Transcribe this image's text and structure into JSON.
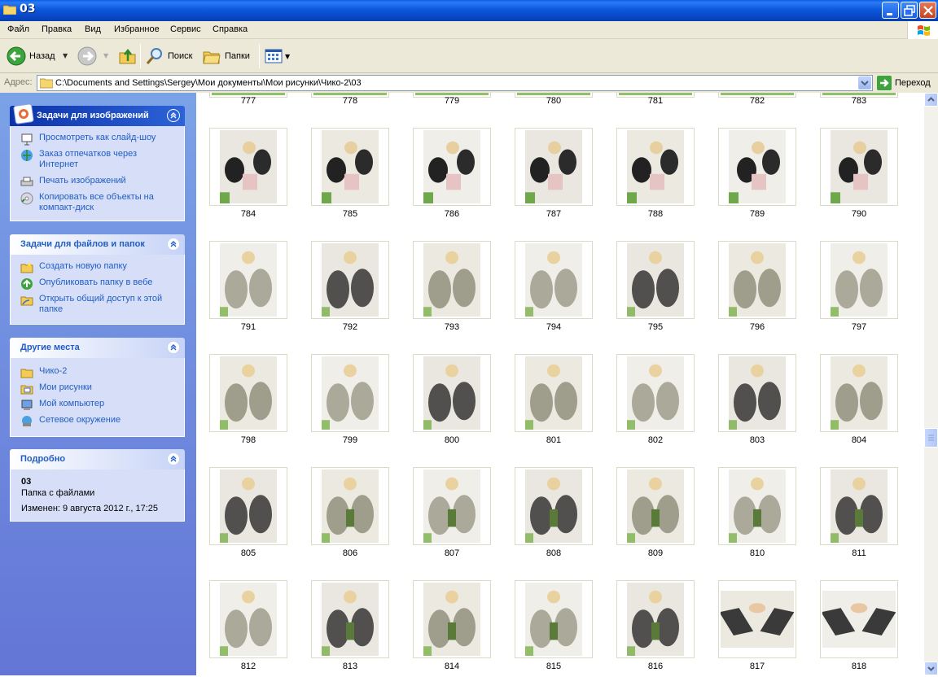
{
  "window": {
    "title": "03"
  },
  "menu": [
    "Файл",
    "Правка",
    "Вид",
    "Избранное",
    "Сервис",
    "Справка"
  ],
  "toolbar": {
    "back_label": "Назад",
    "search_label": "Поиск",
    "folders_label": "Папки"
  },
  "address": {
    "label": "Адрес:",
    "path": "C:\\Documents and Settings\\Sergey\\Мои документы\\Мои рисунки\\Чико-2\\03",
    "go_label": "Переход"
  },
  "panels": {
    "image_tasks": {
      "title": "Задачи для изображений",
      "links": [
        "Просмотреть как слайд-шоу",
        "Заказ отпечатков через Интернет",
        "Печать изображений",
        "Копировать все объекты на компакт-диск"
      ]
    },
    "file_tasks": {
      "title": "Задачи для файлов и папок",
      "links": [
        "Создать новую папку",
        "Опубликовать папку в вебе",
        "Открыть общий доступ к этой папке"
      ]
    },
    "other_places": {
      "title": "Другие места",
      "links": [
        "Чико-2",
        "Мои рисунки",
        "Мой компьютер",
        "Сетевое окружение"
      ]
    },
    "details": {
      "title": "Подробно",
      "name": "03",
      "type": "Папка с файлами",
      "modified": "Изменен: 9 августа 2012 г., 17:25"
    }
  },
  "files": {
    "top_row": [
      "777",
      "778",
      "779",
      "780",
      "781",
      "782",
      "783"
    ],
    "items": [
      "784",
      "785",
      "786",
      "787",
      "788",
      "789",
      "790",
      "791",
      "792",
      "793",
      "794",
      "795",
      "796",
      "797",
      "798",
      "799",
      "800",
      "801",
      "802",
      "803",
      "804",
      "805",
      "806",
      "807",
      "808",
      "809",
      "810",
      "811",
      "812",
      "813",
      "814",
      "815",
      "816",
      "817",
      "818"
    ]
  },
  "colors": {
    "titlebar": "#0a5fe8",
    "link": "#215dc6",
    "pane": "#6b87dc"
  }
}
